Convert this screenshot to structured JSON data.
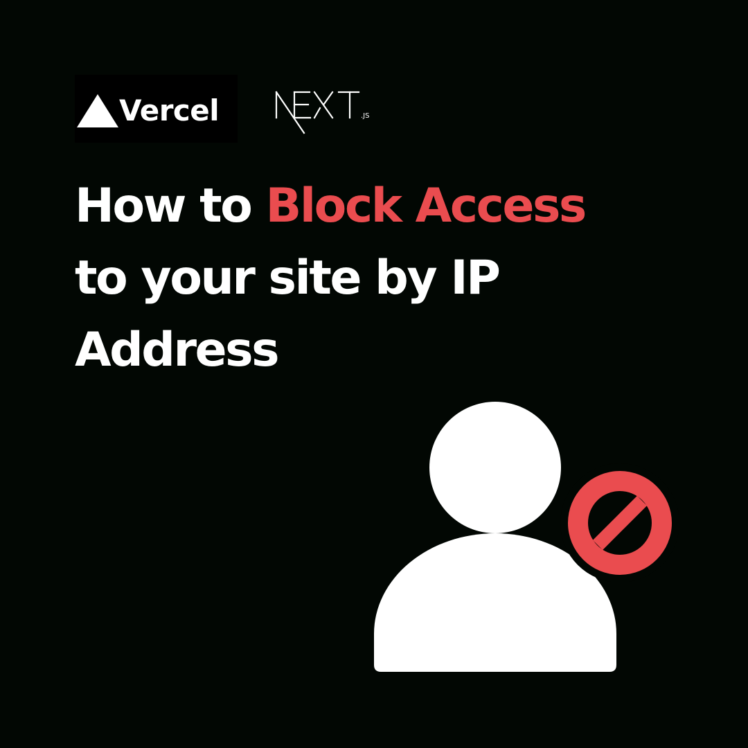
{
  "logos": {
    "vercel": {
      "wordmark": "Vercel",
      "icon": "triangle-icon"
    },
    "next": {
      "wordmark": "NEXT",
      "suffix": ".JS"
    }
  },
  "headline": {
    "line1_prefix": "How to ",
    "line1_highlight": "Block Access",
    "line2": "to your site by IP",
    "line3": "Address"
  },
  "illustration": {
    "icon": "blocked-user-icon",
    "badge_icon": "prohibited-icon"
  },
  "colors": {
    "background": "#020703",
    "text": "#ffffff",
    "accent": "#ea4c4f"
  }
}
